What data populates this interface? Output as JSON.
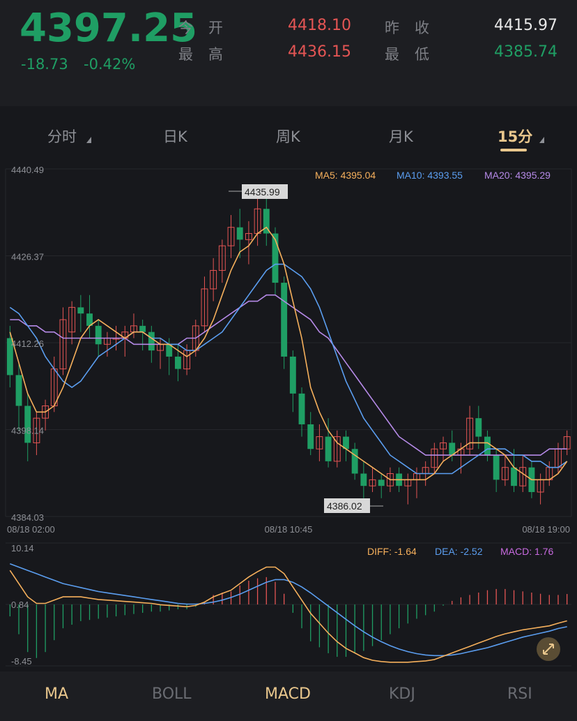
{
  "header": {
    "price": "4397.25",
    "change": "-18.73",
    "change_pct": "-0.42%",
    "open_label": "今开",
    "open_value": "4418.10",
    "prev_close_label": "昨收",
    "prev_close_value": "4415.97",
    "high_label": "最高",
    "high_value": "4436.15",
    "low_label": "最低",
    "low_value": "4385.74"
  },
  "periods": [
    {
      "label": "分时",
      "active": false
    },
    {
      "label": "日K",
      "active": false
    },
    {
      "label": "周K",
      "active": false
    },
    {
      "label": "月K",
      "active": false
    },
    {
      "label": "15分",
      "active": true
    }
  ],
  "legend": {
    "ma5": "MA5: 4395.04",
    "ma10": "MA10: 4393.55",
    "ma20": "MA20: 4395.29",
    "diff": "DIFF: -1.64",
    "dea": "DEA: -2.52",
    "macd": "MACD: 1.76"
  },
  "markers": {
    "high": "4435.99",
    "low": "4386.02"
  },
  "bottom_tabs": [
    {
      "label": "MA",
      "active": true
    },
    {
      "label": "BOLL",
      "active": false
    },
    {
      "label": "MACD",
      "active": true
    },
    {
      "label": "KDJ",
      "active": false
    },
    {
      "label": "RSI",
      "active": false
    }
  ],
  "colors": {
    "up": "#e45554",
    "down": "#1f9e64",
    "ma5": "#f6b05c",
    "ma10": "#5b9ef0",
    "ma20": "#b68ae8",
    "accent": "#e9c78d"
  },
  "chart_data": [
    {
      "type": "candlestick",
      "y_ticks": [
        "4440.49",
        "4426.37",
        "4412.26",
        "4398.14",
        "4384.03"
      ],
      "ylim": [
        4384.03,
        4440.49
      ],
      "x_labels": [
        "08/18 02:00",
        "08/18 10:45",
        "08/18 19:00"
      ],
      "candles": [
        [
          4413,
          4415,
          4405,
          4407
        ],
        [
          4407,
          4409,
          4398,
          4402
        ],
        [
          4402,
          4404,
          4393,
          4396
        ],
        [
          4396,
          4401,
          4394,
          4400
        ],
        [
          4400,
          4403,
          4398,
          4402
        ],
        [
          4402,
          4410,
          4401,
          4408
        ],
        [
          4408,
          4418,
          4407,
          4416
        ],
        [
          4414,
          4419,
          4412,
          4418
        ],
        [
          4418,
          4420,
          4414,
          4417
        ],
        [
          4417,
          4420,
          4413,
          4415
        ],
        [
          4415,
          4416,
          4410,
          4412
        ],
        [
          4412,
          4414,
          4410,
          4413
        ],
        [
          4413,
          4415,
          4411,
          4413
        ],
        [
          4413,
          4415,
          4410,
          4414
        ],
        [
          4414,
          4417,
          4413,
          4415
        ],
        [
          4415,
          4416,
          4411,
          4414
        ],
        [
          4414,
          4415,
          4409,
          4411
        ],
        [
          4411,
          4413,
          4408,
          4412
        ],
        [
          4412,
          4413,
          4407,
          4410
        ],
        [
          4410,
          4412,
          4406,
          4408
        ],
        [
          4408,
          4412,
          4407,
          4411
        ],
        [
          4411,
          4416,
          4410,
          4415
        ],
        [
          4415,
          4423,
          4414,
          4421
        ],
        [
          4421,
          4426,
          4419,
          4424
        ],
        [
          4424,
          4429,
          4422,
          4428
        ],
        [
          4428,
          4433,
          4426,
          4431
        ],
        [
          4431,
          4434,
          4426,
          4429
        ],
        [
          4429,
          4432,
          4425,
          4430
        ],
        [
          4430,
          4436,
          4428,
          4434
        ],
        [
          4434,
          4436,
          4428,
          4430
        ],
        [
          4430,
          4431,
          4420,
          4422
        ],
        [
          4422,
          4423,
          4408,
          4410
        ],
        [
          4410,
          4411,
          4401,
          4404
        ],
        [
          4404,
          4405,
          4397,
          4399
        ],
        [
          4399,
          4401,
          4394,
          4395
        ],
        [
          4395,
          4399,
          4393,
          4397
        ],
        [
          4397,
          4400,
          4392,
          4393
        ],
        [
          4393,
          4398,
          4392,
          4397
        ],
        [
          4397,
          4398,
          4393,
          4395
        ],
        [
          4395,
          4396,
          4390,
          4391
        ],
        [
          4391,
          4393,
          4387,
          4389
        ],
        [
          4389,
          4392,
          4388,
          4390
        ],
        [
          4390,
          4391,
          4387,
          4389
        ],
        [
          4389,
          4392,
          4388,
          4391
        ],
        [
          4391,
          4392,
          4388,
          4389
        ],
        [
          4389,
          4391,
          4386,
          4390
        ],
        [
          4390,
          4392,
          4387,
          4391
        ],
        [
          4391,
          4393,
          4389,
          4392
        ],
        [
          4392,
          4396,
          4391,
          4395
        ],
        [
          4395,
          4397,
          4393,
          4396
        ],
        [
          4396,
          4398,
          4393,
          4394
        ],
        [
          4394,
          4396,
          4391,
          4395
        ],
        [
          4395,
          4402,
          4394,
          4400
        ],
        [
          4400,
          4402,
          4395,
          4397
        ],
        [
          4397,
          4398,
          4393,
          4394
        ],
        [
          4394,
          4395,
          4388,
          4390
        ],
        [
          4390,
          4394,
          4389,
          4392
        ],
        [
          4392,
          4395,
          4388,
          4389
        ],
        [
          4389,
          4394,
          4388,
          4392
        ],
        [
          4392,
          4393,
          4387,
          4388
        ],
        [
          4388,
          4391,
          4386,
          4390
        ],
        [
          4390,
          4393,
          4389,
          4392
        ],
        [
          4392,
          4396,
          4391,
          4395
        ],
        [
          4395,
          4398,
          4394,
          4397
        ]
      ],
      "ma5": [
        4414,
        4409,
        4404,
        4401,
        4401,
        4402,
        4405,
        4409,
        4413,
        4415,
        4416,
        4415,
        4414,
        4413,
        4414,
        4414,
        4413,
        4412,
        4412,
        4411,
        4410,
        4411,
        4413,
        4416,
        4420,
        4424,
        4427,
        4428,
        4430,
        4431,
        4429,
        4425,
        4419,
        4413,
        4405,
        4401,
        4398,
        4396,
        4395,
        4394,
        4393,
        4392,
        4391,
        4390,
        4390,
        4390,
        4390,
        4390,
        4391,
        4393,
        4394,
        4395,
        4396,
        4396,
        4396,
        4395,
        4394,
        4392,
        4391,
        4390,
        4390,
        4390,
        4391,
        4393
      ],
      "ma10": [
        4418,
        4417,
        4415,
        4413,
        4410,
        4408,
        4406,
        4405,
        4406,
        4408,
        4410,
        4411,
        4412,
        4413,
        4414,
        4414,
        4413,
        4413,
        4412,
        4412,
        4411,
        4411,
        4412,
        4413,
        4414,
        4416,
        4418,
        4420,
        4422,
        4424,
        4425,
        4425,
        4424,
        4423,
        4421,
        4418,
        4414,
        4410,
        4406,
        4403,
        4400,
        4398,
        4396,
        4394,
        4393,
        4392,
        4391,
        4391,
        4391,
        4391,
        4391,
        4392,
        4393,
        4394,
        4395,
        4395,
        4395,
        4394,
        4394,
        4393,
        4393,
        4392,
        4392,
        4393
      ],
      "ma20": [
        4416,
        4416,
        4415,
        4415,
        4414,
        4414,
        4413,
        4413,
        4413,
        4413,
        4413,
        4413,
        4413,
        4413,
        4412,
        4412,
        4412,
        4412,
        4412,
        4412,
        4413,
        4413,
        4414,
        4415,
        4416,
        4417,
        4418,
        4419,
        4419,
        4420,
        4420,
        4419,
        4418,
        4417,
        4416,
        4414,
        4413,
        4411,
        4409,
        4407,
        4405,
        4403,
        4401,
        4399,
        4397,
        4396,
        4395,
        4394,
        4394,
        4394,
        4394,
        4394,
        4394,
        4394,
        4394,
        4394,
        4394,
        4394,
        4394,
        4394,
        4394,
        4395,
        4395,
        4395
      ]
    },
    {
      "type": "macd",
      "y_ticks": [
        "10.14",
        "0.84",
        "-8.45"
      ],
      "ylim": [
        -8.45,
        10.14
      ],
      "diff": [
        6,
        4,
        2,
        1,
        1,
        1.5,
        2,
        2,
        2,
        1.8,
        1.6,
        1.5,
        1.4,
        1.3,
        1.2,
        1.1,
        1,
        0.8,
        0.7,
        0.6,
        0.5,
        0.7,
        1.2,
        2,
        2.5,
        3,
        4,
        5,
        5.8,
        6.5,
        6.5,
        5.5,
        3.5,
        1.5,
        -0.5,
        -2,
        -3.5,
        -4.8,
        -5.8,
        -6.5,
        -7.2,
        -7.6,
        -7.8,
        -7.9,
        -7.9,
        -7.9,
        -7.8,
        -7.7,
        -7.5,
        -7,
        -6.5,
        -6,
        -5.5,
        -5,
        -4.5,
        -4,
        -3.6,
        -3.3,
        -3,
        -2.8,
        -2.6,
        -2.4,
        -2,
        -1.64
      ],
      "dea": [
        7,
        6.5,
        6,
        5.5,
        5,
        4.5,
        4,
        3.7,
        3.4,
        3.1,
        2.8,
        2.6,
        2.4,
        2.2,
        2,
        1.8,
        1.6,
        1.4,
        1.2,
        1,
        0.9,
        0.9,
        1,
        1.2,
        1.5,
        1.9,
        2.4,
        3,
        3.6,
        4.2,
        4.6,
        4.6,
        4.2,
        3.5,
        2.6,
        1.6,
        0.6,
        -0.4,
        -1.4,
        -2.4,
        -3.3,
        -4.1,
        -4.8,
        -5.4,
        -5.9,
        -6.3,
        -6.6,
        -6.8,
        -6.9,
        -6.9,
        -6.8,
        -6.6,
        -6.3,
        -6,
        -5.7,
        -5.3,
        -4.9,
        -4.5,
        -4.1,
        -3.8,
        -3.5,
        -3.2,
        -2.8,
        -2.52
      ],
      "macd": [
        -2,
        -5,
        -8,
        -9,
        -8,
        -6,
        -4,
        -3.4,
        -2.8,
        -2.6,
        -2.4,
        -2.2,
        -2,
        -1.8,
        -1.6,
        -1.4,
        -1.2,
        -1.2,
        -1,
        -0.8,
        -0.8,
        -0.4,
        0.4,
        1.6,
        2,
        2.2,
        3.2,
        4,
        4.4,
        4.6,
        3.8,
        1.8,
        -1.4,
        -4,
        -6.2,
        -7.2,
        -8.2,
        -8.8,
        -8.8,
        -8.2,
        -7.8,
        -7,
        -6,
        -5,
        -4,
        -3.2,
        -2.4,
        -1.8,
        -1.2,
        -0.2,
        0.6,
        1.2,
        1.6,
        2,
        2.4,
        2.6,
        2.6,
        2.4,
        2.2,
        2,
        1.8,
        1.6,
        1.6,
        1.76
      ]
    }
  ]
}
